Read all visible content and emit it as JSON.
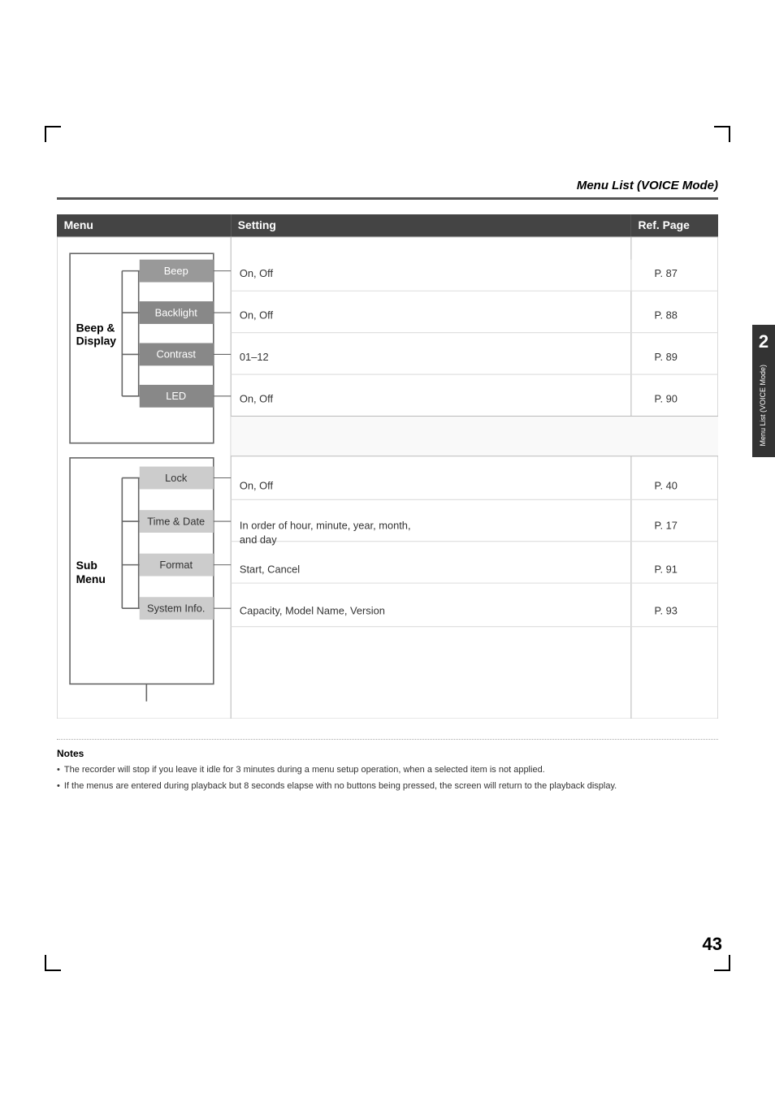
{
  "page": {
    "title": "Menu List (VOICE Mode)",
    "number": "43",
    "side_tab_number": "2",
    "side_tab_text": "Menu List (VOICE Mode)"
  },
  "table": {
    "headers": {
      "menu": "Menu",
      "setting": "Setting",
      "ref_page": "Ref. Page"
    }
  },
  "groups": [
    {
      "label": "Beep &\nDisplay",
      "items": [
        {
          "name": "Beep",
          "setting": "On, Off",
          "ref": "P. 87"
        },
        {
          "name": "Backlight",
          "setting": "On, Off",
          "ref": "P. 88"
        },
        {
          "name": "Contrast",
          "setting": "01–12",
          "ref": "P. 89"
        },
        {
          "name": "LED",
          "setting": "On, Off",
          "ref": "P. 90"
        }
      ]
    },
    {
      "label": "Sub\nMenu",
      "items": [
        {
          "name": "Lock",
          "setting": "On, Off",
          "ref": "P. 40"
        },
        {
          "name": "Time & Date",
          "setting": "In order of hour, minute, year, month, and day",
          "ref": "P. 17"
        },
        {
          "name": "Format",
          "setting": "Start, Cancel",
          "ref": "P. 91"
        },
        {
          "name": "System Info.",
          "setting": "Capacity, Model Name, Version",
          "ref": "P. 93"
        }
      ]
    }
  ],
  "notes": {
    "title": "Notes",
    "items": [
      "The recorder will stop if you leave it idle for 3 minutes during a menu setup operation, when a selected item is not applied.",
      "If the menus are entered during playback but 8 seconds elapse with no buttons being pressed, the screen will return to the playback display."
    ]
  }
}
